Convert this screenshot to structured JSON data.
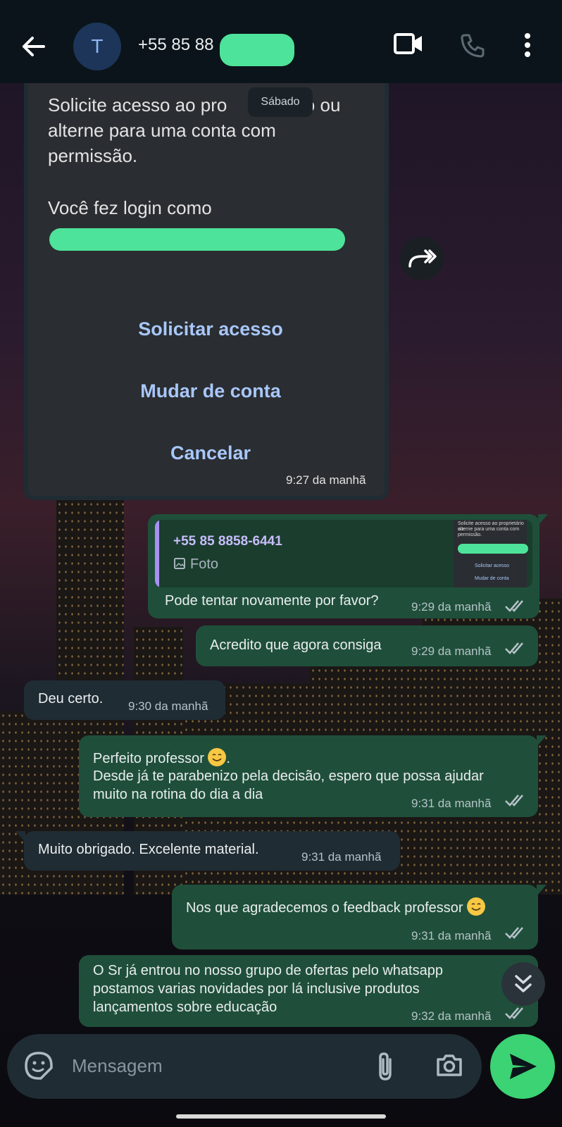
{
  "header": {
    "avatar_letter": "T",
    "contact_name": "+55 85 88"
  },
  "icons": {
    "back": "arrow-left-icon",
    "video": "video-call-icon",
    "voice": "voice-call-icon",
    "menu": "more-vert-icon",
    "forward": "forward-icon",
    "scroll_down": "double-chevron-down-icon",
    "sticker": "sticker-icon",
    "attach": "paperclip-icon",
    "camera": "camera-icon",
    "send": "send-icon"
  },
  "colors": {
    "incoming_bubble": "#202c33",
    "outgoing_bubble": "#1f4f3a",
    "send_button": "#3bd373",
    "quote_bar": "#a791f2"
  },
  "date_chip": "Sábado",
  "screenshot_message": {
    "text_lines": [
      "Solicite acesso ao pro",
      "rio ou",
      "alterne para uma conta com",
      "permissão."
    ],
    "login_text": "Você fez login como",
    "action_request": "Solicitar acesso",
    "action_switch": "Mudar de conta",
    "action_cancel": "Cancelar",
    "time": "9:27 da manhã"
  },
  "quote": {
    "name": "+55 85 8858-6441",
    "type": "Foto",
    "thumb_line1": "Solicite acesso ao proprietário ou",
    "thumb_line2": "alterne para uma conta com",
    "thumb_line3": "permissão.",
    "thumb_action1": "Solicitar acesso",
    "thumb_action2": "Mudar de conta"
  },
  "messages": [
    {
      "text": "Pode tentar novamente por favor?",
      "time": "9:29 da manhã"
    },
    {
      "text": "Acredito que agora consiga",
      "time": "9:29 da manhã"
    },
    {
      "text": "Deu certo.",
      "time": "9:30 da manhã"
    },
    {
      "line1": "Perfeito professor",
      "line1_end": ".",
      "line2": "Desde já te parabenizo pela decisão, espero que possa ajudar",
      "line3": "muito na rotina do dia a dia",
      "time": "9:31 da manhã"
    },
    {
      "text": "Muito obrigado. Excelente material.",
      "time": "9:31 da manhã"
    },
    {
      "text": "Nos que agradecemos o feedback professor",
      "time": "9:31 da manhã"
    },
    {
      "line1": "O Sr já entrou no nosso grupo de ofertas pelo whatsapp",
      "line2": "postamos varias novidades por lá inclusive produtos",
      "line3": "lançamentos sobre educação",
      "time": "9:32 da manhã"
    }
  ],
  "composer": {
    "placeholder": "Mensagem"
  }
}
